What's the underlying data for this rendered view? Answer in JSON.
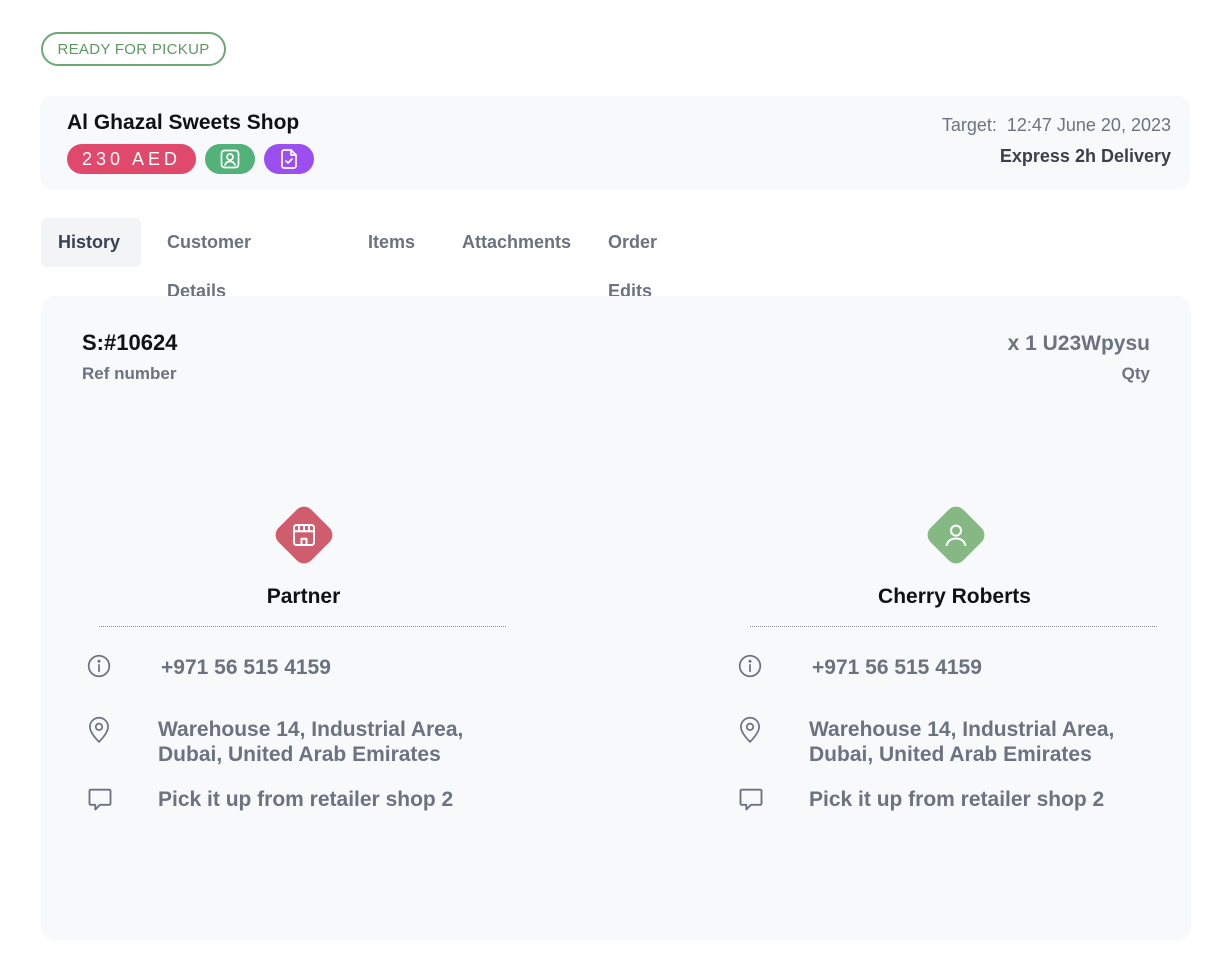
{
  "status": "READY FOR PICKUP",
  "header": {
    "shop_name": "Al Ghazal Sweets Shop",
    "price": "230 AED",
    "target_label": "Target:",
    "target_value": "12:47 June 20, 2023",
    "delivery_type": "Express 2h Delivery",
    "badges": [
      {
        "icon": "contact-card-icon",
        "color": "#52b27a"
      },
      {
        "icon": "document-check-icon",
        "color": "#9b4ff0"
      }
    ]
  },
  "tabs": [
    "History",
    "Customer Details",
    "Items",
    "Attachments",
    "Order Edits"
  ],
  "active_tab": "History",
  "order": {
    "ref_number": "S:#10624",
    "ref_caption": "Ref number",
    "qty_value": "x 1 U23Wpysu",
    "qty_caption": "Qty"
  },
  "parties": [
    {
      "name": "Partner",
      "icon": "store-icon",
      "color": "#d05d6e",
      "phone": "+971 56 515 4159",
      "address_line1": "Warehouse 14, Industrial Area,",
      "address_line2": "Dubai, United Arab Emirates",
      "note": "Pick it up from retailer shop 2"
    },
    {
      "name": "Cherry Roberts",
      "icon": "user-icon",
      "color": "#85b882",
      "phone": "+971 56 515 4159",
      "address_line1": "Warehouse 14, Industrial Area,",
      "address_line2": "Dubai, United Arab Emirates",
      "note": "Pick it up from retailer shop 2"
    }
  ]
}
